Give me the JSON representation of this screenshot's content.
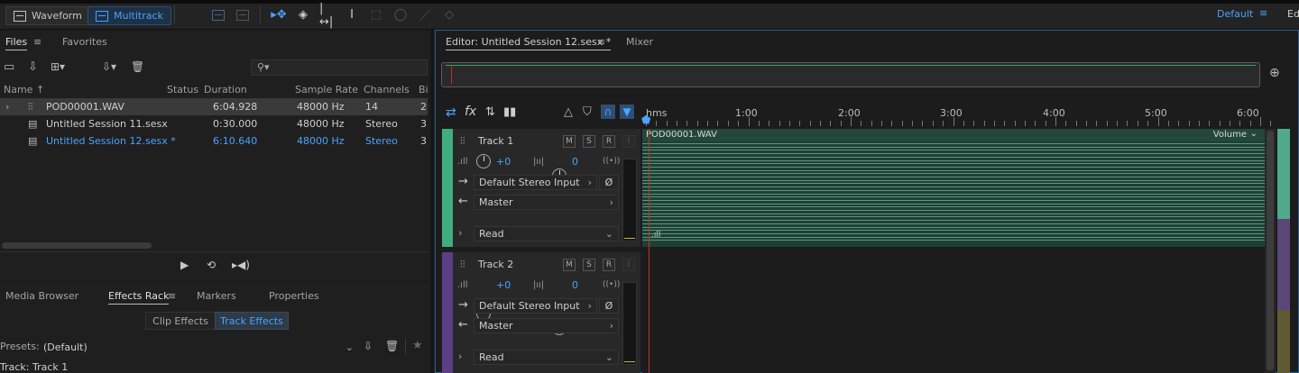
{
  "topbar": {
    "waveform_label": "Waveform",
    "multitrack_label": "Multitrack",
    "workspace_label": "Default",
    "edit_label": "Ed"
  },
  "files_panel": {
    "tabs": [
      "Files",
      "Favorites"
    ],
    "search_placeholder": "",
    "columns": [
      "Name",
      "Status",
      "Duration",
      "Sample Rate",
      "Channels",
      "Bi"
    ],
    "rows": [
      {
        "name": "POD00001.WAV",
        "status": "",
        "duration": "6:04.928",
        "rate": "48000 Hz",
        "channels": "14",
        "bits": "2"
      },
      {
        "name": "Untitled Session 11.sesx",
        "status": "",
        "duration": "0:30.000",
        "rate": "48000 Hz",
        "channels": "Stereo",
        "bits": "3"
      },
      {
        "name": "Untitled Session 12.sesx *",
        "status": "",
        "duration": "6:10.640",
        "rate": "48000 Hz",
        "channels": "Stereo",
        "bits": "3"
      }
    ]
  },
  "lower_panel": {
    "tabs": [
      "Media Browser",
      "Effects Rack",
      "Markers",
      "Properties"
    ],
    "subtabs": [
      "Clip Effects",
      "Track Effects"
    ],
    "presets_label": "Presets:",
    "presets_value": "(Default)",
    "track_label": "Track: Track 1"
  },
  "editor": {
    "tab_title": "Editor: Untitled Session 12.sesx *",
    "mixer_label": "Mixer",
    "ruler": [
      "hms",
      "1:00",
      "2:00",
      "3:00",
      "4:00",
      "5:00",
      "6:00"
    ],
    "clip_name": "POD00001.WAV",
    "clip_param": "Volume",
    "tracks": [
      {
        "name": "Track 1",
        "vol": "+0",
        "pan": "0",
        "input": "Default Stereo Input",
        "output": "Master",
        "automation": "Read",
        "color": "#3fae7e"
      },
      {
        "name": "Track 2",
        "vol": "+0",
        "pan": "0",
        "input": "Default Stereo Input",
        "output": "Master",
        "automation": "Read",
        "color": "#5a3f86"
      }
    ],
    "track_buttons": [
      "M",
      "S",
      "R",
      "I"
    ],
    "stereo_symbol": "((•))",
    "phase_symbol": "Ø"
  },
  "icons": [
    "waveform-icon",
    "multitrack-icon",
    "move-tool-icon",
    "razor-icon",
    "slip-icon",
    "time-selection-icon",
    "marquee-icon",
    "lasso-icon",
    "brush-icon",
    "healing-icon",
    "folder-open-icon",
    "import-icon",
    "new-file-icon",
    "insert-icon",
    "delete-icon",
    "play-icon",
    "loop-icon",
    "autoplay-icon",
    "zoom-icon",
    "save-preset-icon",
    "star-icon"
  ]
}
